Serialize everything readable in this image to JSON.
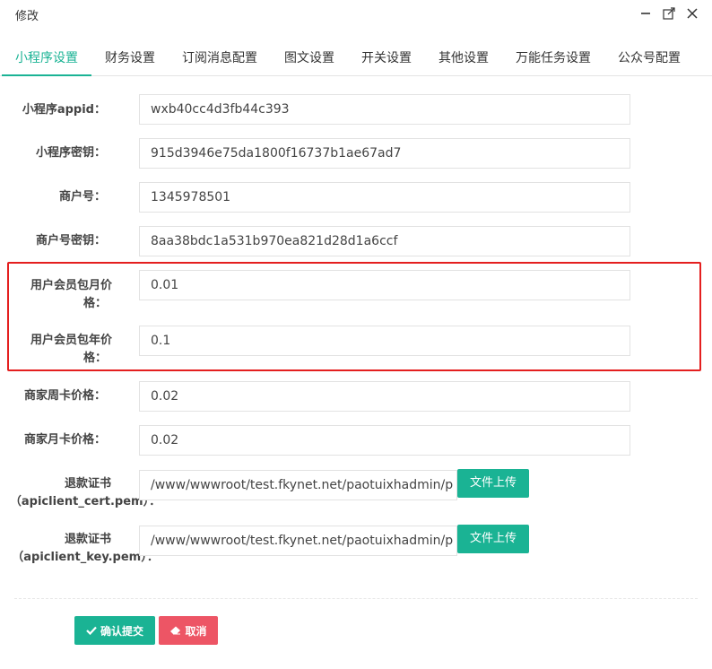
{
  "window": {
    "title": "修改"
  },
  "tabs": [
    {
      "label": "小程序设置",
      "active": true
    },
    {
      "label": "财务设置",
      "active": false
    },
    {
      "label": "订阅消息配置",
      "active": false
    },
    {
      "label": "图文设置",
      "active": false
    },
    {
      "label": "开关设置",
      "active": false
    },
    {
      "label": "其他设置",
      "active": false
    },
    {
      "label": "万能任务设置",
      "active": false
    },
    {
      "label": "公众号配置",
      "active": false
    }
  ],
  "form": {
    "appid": {
      "label": "小程序appid：",
      "value": "wxb40cc4d3fb44c393"
    },
    "secret": {
      "label": "小程序密钥：",
      "value": "915d3946e75da1800f16737b1ae67ad7"
    },
    "mch_id": {
      "label": "商户号：",
      "value": "1345978501"
    },
    "mch_key": {
      "label": "商户号密钥：",
      "value": "8aa38bdc1a531b970ea821d28d1a6ccf"
    },
    "member_month": {
      "label_line1": "用户会员包月价",
      "label_line2": "格：",
      "value": "0.01"
    },
    "member_year": {
      "label_line1": "用户会员包年价",
      "label_line2": "格：",
      "value": "0.1"
    },
    "shop_week": {
      "label": "商家周卡价格：",
      "value": "0.02"
    },
    "shop_month": {
      "label": "商家月卡价格：",
      "value": "0.02"
    },
    "cert": {
      "label_line1": "退款证书",
      "label_line2": "（apiclient_cert.pem）：",
      "value": "/www/wwwroot/test.fkynet.net/paotuixhadmin/p",
      "upload_label": "文件上传"
    },
    "key": {
      "label_line1": "退款证书",
      "label_line2": "（apiclient_key.pem）：",
      "value": "/www/wwwroot/test.fkynet.net/paotuixhadmin/p",
      "upload_label": "文件上传"
    }
  },
  "actions": {
    "submit_label": "确认提交",
    "cancel_label": "取消"
  },
  "colors": {
    "accent": "#1ab394",
    "danger": "#ed5565",
    "highlight": "#e41f1f"
  }
}
